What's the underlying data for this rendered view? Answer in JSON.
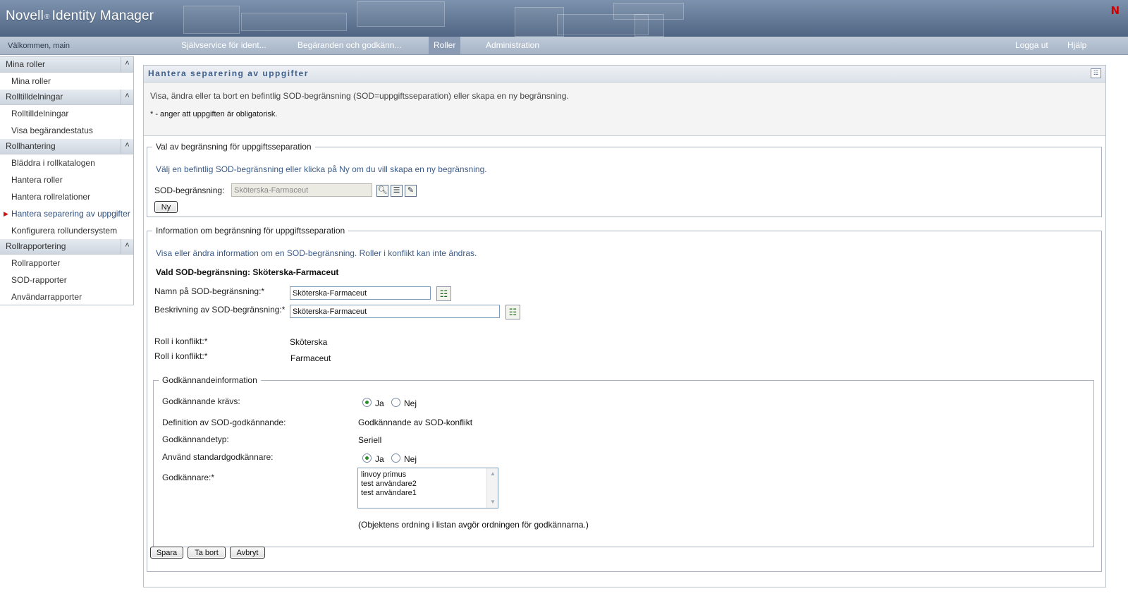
{
  "header": {
    "brand": "Novell",
    "reg_mark": "®",
    "product": "Identity Manager",
    "logo_letter": "N"
  },
  "nav": {
    "welcome": "Välkommen, main",
    "items": [
      {
        "label": "Självservice för ident..."
      },
      {
        "label": "Begäranden och godkänn..."
      },
      {
        "label": "Roller"
      },
      {
        "label": "Administration"
      }
    ],
    "active": "Roller",
    "logout": "Logga ut",
    "help": "Hjälp"
  },
  "sidebar": {
    "sections": [
      {
        "title": "Mina roller",
        "items": [
          "Mina roller"
        ]
      },
      {
        "title": "Rolltilldelningar",
        "items": [
          "Rolltilldelningar",
          "Visa begärandestatus"
        ]
      },
      {
        "title": "Rollhantering",
        "items": [
          "Bläddra i rollkatalogen",
          "Hantera roller",
          "Hantera rollrelationer",
          "Hantera separering av uppgifter",
          "Konfigurera rollundersystem"
        ]
      },
      {
        "title": "Rollrapportering",
        "items": [
          "Rollrapporter",
          "SOD-rapporter",
          "Användarrapporter"
        ]
      }
    ],
    "current": "Hantera separering av uppgifter"
  },
  "panel": {
    "title": "Hantera separering av uppgifter",
    "description": "Visa, ändra eller ta bort en befintlig SOD-begränsning (SOD=uppgiftsseparation) eller skapa en ny begränsning.",
    "required_note": "* - anger att uppgiften är obligatorisk."
  },
  "selection": {
    "legend": "Val av begränsning för uppgiftsseparation",
    "help": "Välj en befintlig SOD-begränsning eller klicka på Ny om du vill skapa en ny begränsning.",
    "label": "SOD-begränsning:",
    "value": "Sköterska-Farmaceut",
    "new_button": "Ny"
  },
  "info": {
    "legend": "Information om begränsning för uppgiftsseparation",
    "help": "Visa eller ändra information om en SOD-begränsning. Roller i konflikt kan inte ändras.",
    "selected_heading": "Vald SOD-begränsning: Sköterska-Farmaceut",
    "name_label": "Namn på SOD-begränsning:*",
    "name_value": "Sköterska-Farmaceut",
    "desc_label": "Beskrivning av SOD-begränsning:*",
    "desc_value": "Sköterska-Farmaceut",
    "conflict_label_1": "Roll i konflikt:*",
    "conflict_value_1": "Sköterska",
    "conflict_label_2": "Roll i konflikt:*",
    "conflict_value_2": "Farmaceut"
  },
  "approval": {
    "legend": "Godkännandeinformation",
    "required_label": "Godkännande krävs:",
    "yes": "Ja",
    "no": "Nej",
    "required_selected": "Ja",
    "definition_label": "Definition av SOD-godkännande:",
    "definition_value": "Godkännande av SOD-konflikt",
    "type_label": "Godkännandetyp:",
    "type_value": "Seriell",
    "default_label": "Använd standardgodkännare:",
    "default_selected": "Ja",
    "approvers_label": "Godkännare:*",
    "approvers": [
      "linvoy primus",
      "test användare2",
      "test användare1"
    ],
    "order_note": "(Objektens ordning i listan avgör ordningen för godkännarna.)"
  },
  "actions": {
    "save": "Spara",
    "delete": "Ta bort",
    "cancel": "Avbryt"
  },
  "colors": {
    "header": "#5f7594",
    "nav": "#b3bfcf",
    "help_text": "#3c5b88",
    "logo": "#cc0000"
  }
}
